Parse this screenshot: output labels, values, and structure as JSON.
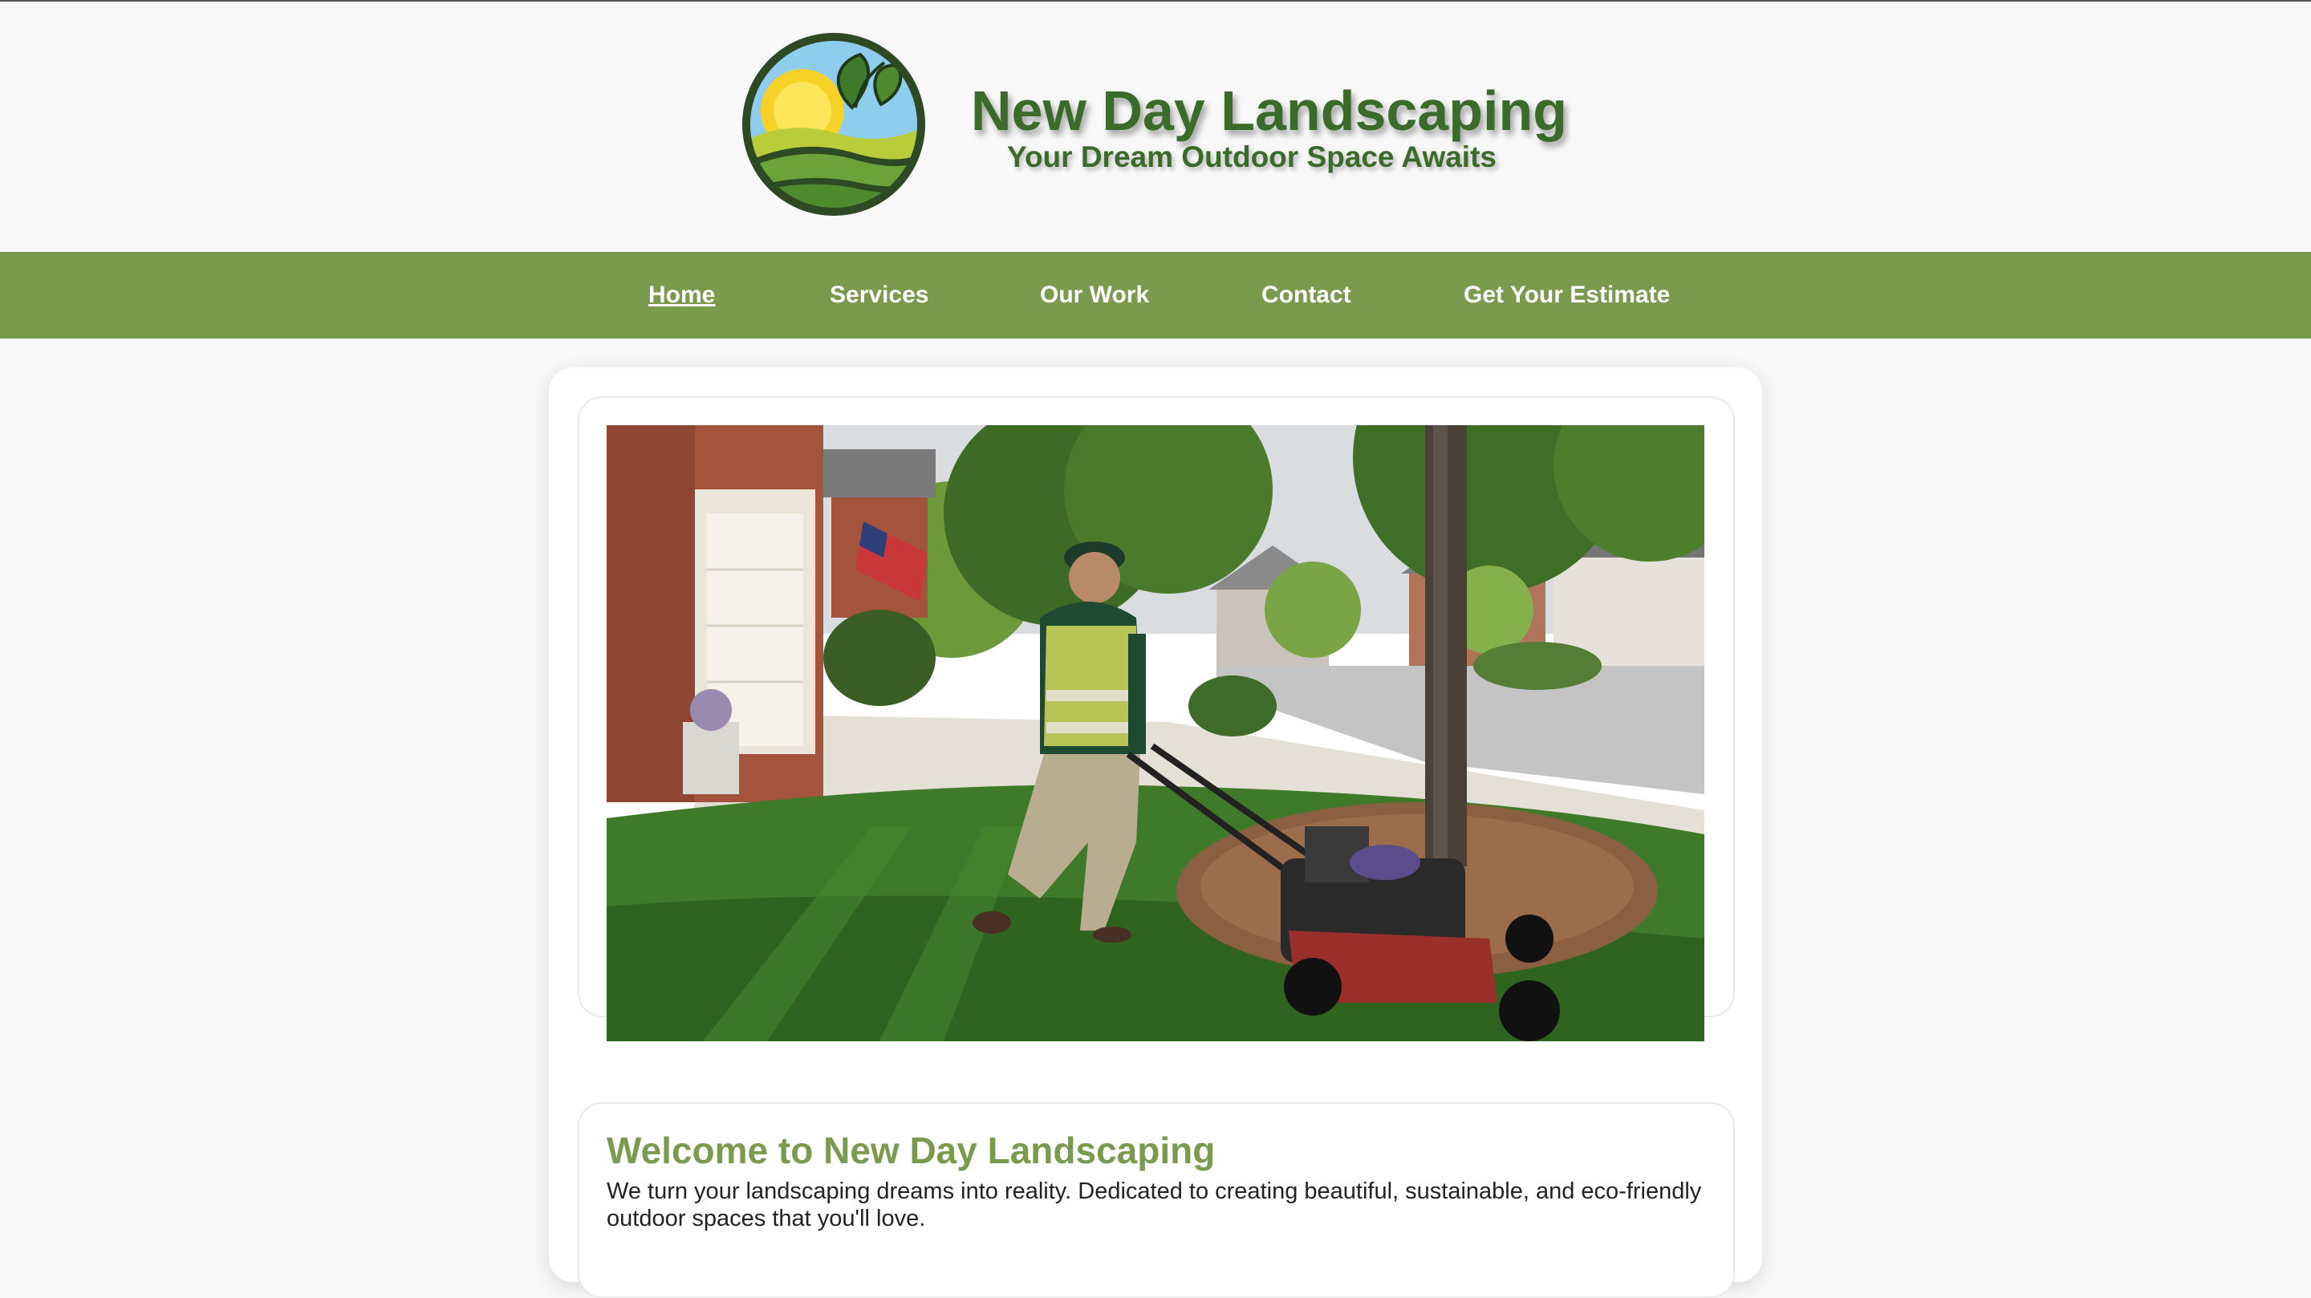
{
  "brand": {
    "title": "New Day Landscaping",
    "tagline": "Your Dream Outdoor Space Awaits",
    "logo_icon": "sun-over-hills-leaf-logo"
  },
  "nav": {
    "items": [
      {
        "label": "Home",
        "active": true
      },
      {
        "label": "Services",
        "active": false
      },
      {
        "label": "Our Work",
        "active": false
      },
      {
        "label": "Contact",
        "active": false
      },
      {
        "label": "Get Your Estimate",
        "active": false
      }
    ]
  },
  "hero": {
    "description_icon": "photo-lawn-mowing"
  },
  "welcome": {
    "heading": "Welcome to New Day Landscaping",
    "body": "We turn your landscaping dreams into reality. Dedicated to creating beautiful, sustainable, and eco-friendly outdoor spaces that you'll love."
  },
  "colors": {
    "brand_green": "#3b6b2a",
    "nav_green": "#7a9a4e",
    "page_bg": "#f8f8f8"
  }
}
